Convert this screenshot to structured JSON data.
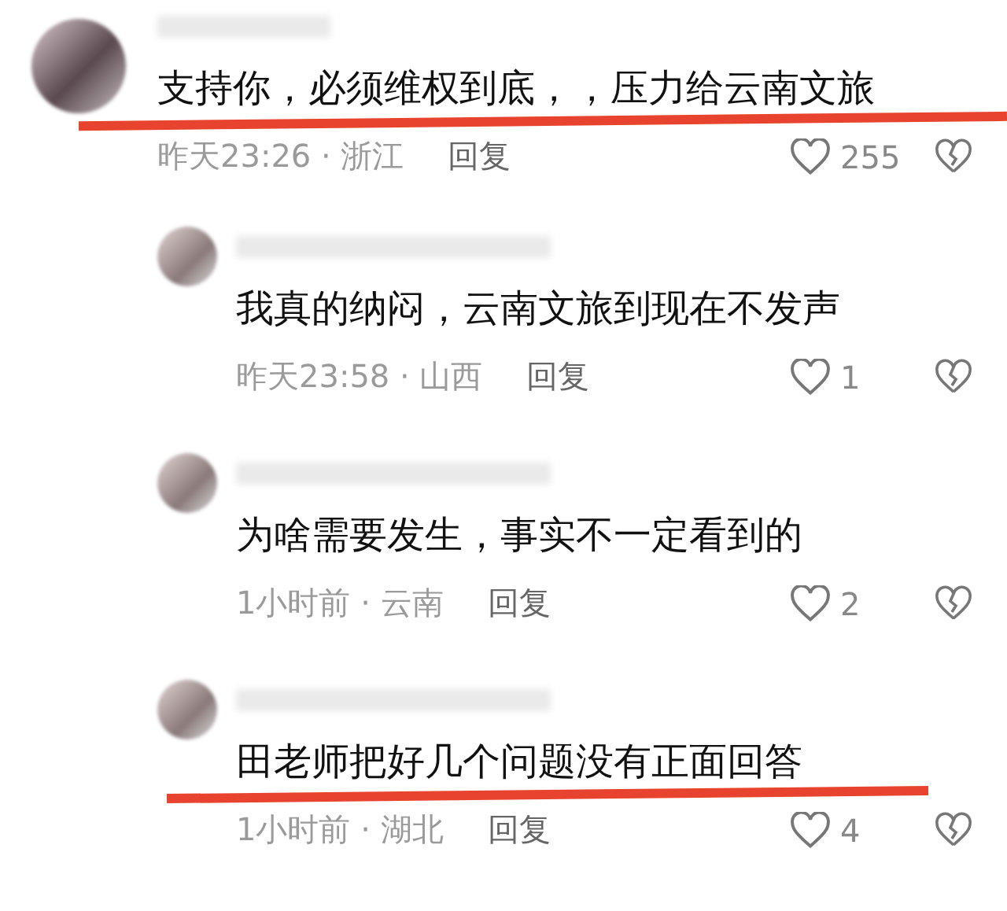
{
  "comments": [
    {
      "text": "支持你，必须维权到底，，压力给云南文旅",
      "meta": "昨天23:26 · 浙江",
      "reply_label": "回复",
      "likes": "255",
      "underlined": true,
      "children": [
        {
          "text": "我真的纳闷，云南文旅到现在不发声",
          "meta": "昨天23:58 · 山西",
          "reply_label": "回复",
          "likes": "1",
          "underlined": false
        },
        {
          "text": "为啥需要发生，事实不一定看到的",
          "meta": "1小时前 · 云南",
          "reply_label": "回复",
          "likes": "2",
          "underlined": false
        },
        {
          "text": "田老师把好几个问题没有正面回答",
          "meta": "1小时前 · 湖北",
          "reply_label": "回复",
          "likes": "4",
          "underlined": true
        }
      ]
    }
  ]
}
